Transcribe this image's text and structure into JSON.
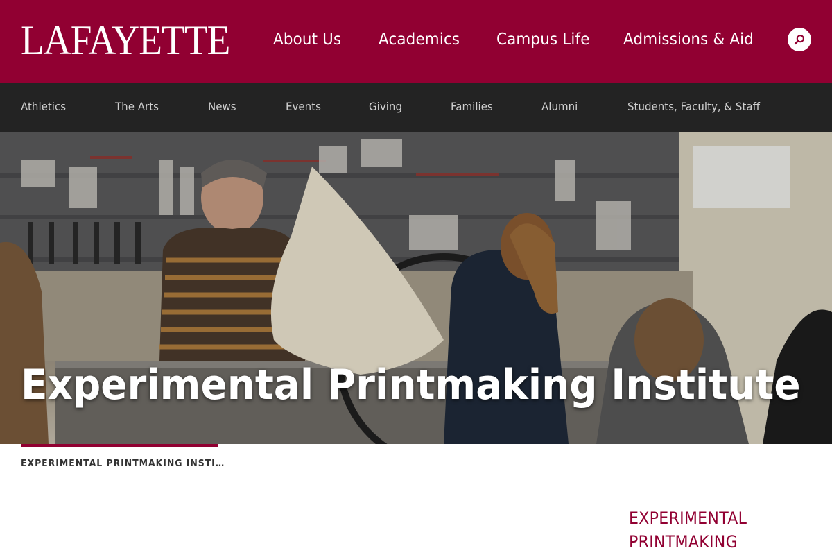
{
  "header": {
    "logo_text": "LAFAYETTE",
    "brand_color": "#910032",
    "primary_nav": [
      {
        "label": "About Us"
      },
      {
        "label": "Academics"
      },
      {
        "label": "Campus Life"
      },
      {
        "label": "Admissions & Aid"
      }
    ],
    "search_icon": "search-icon"
  },
  "secondary_nav": {
    "background": "#232323",
    "items": [
      {
        "label": "Athletics"
      },
      {
        "label": "The Arts"
      },
      {
        "label": "News"
      },
      {
        "label": "Events"
      },
      {
        "label": "Giving"
      },
      {
        "label": "Families"
      },
      {
        "label": "Alumni"
      },
      {
        "label": "Students, Faculty, & Staff"
      }
    ]
  },
  "hero": {
    "title": "Experimental Printmaking Institute"
  },
  "breadcrumb": {
    "current": "EXPERIMENTAL PRINTMAKING INSTI…"
  },
  "sidebar": {
    "heading_line1": "EXPERIMENTAL",
    "heading_line2": "PRINTMAKING"
  }
}
